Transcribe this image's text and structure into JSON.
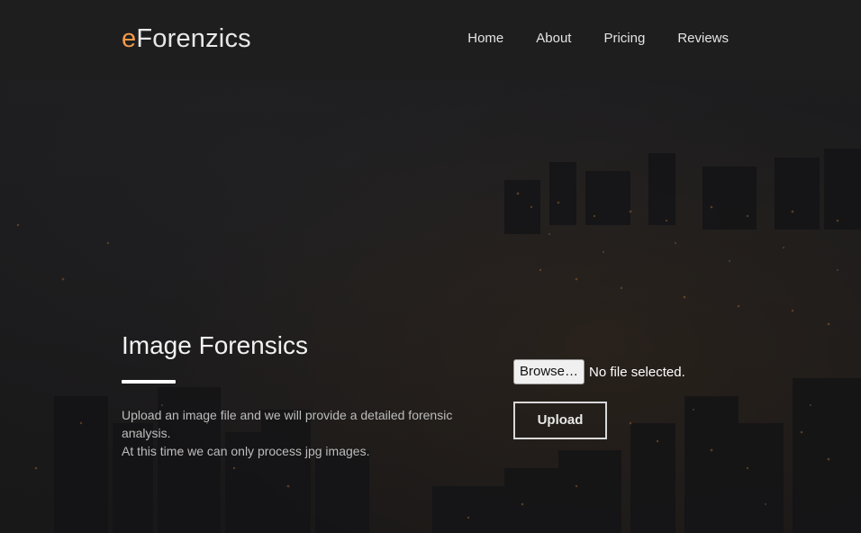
{
  "brand": {
    "accent": "e",
    "rest": "Forenzics",
    "accent_color": "#f39a4a"
  },
  "nav": {
    "items": [
      "Home",
      "About",
      "Pricing",
      "Reviews"
    ]
  },
  "main": {
    "title": "Image Forensics",
    "description_line1": "Upload an image file and we will provide a detailed forensic analysis.",
    "description_line2": "At this time we can only process jpg images."
  },
  "upload": {
    "browse_label": "Browse…",
    "file_status": "No file selected.",
    "submit_label": "Upload"
  }
}
